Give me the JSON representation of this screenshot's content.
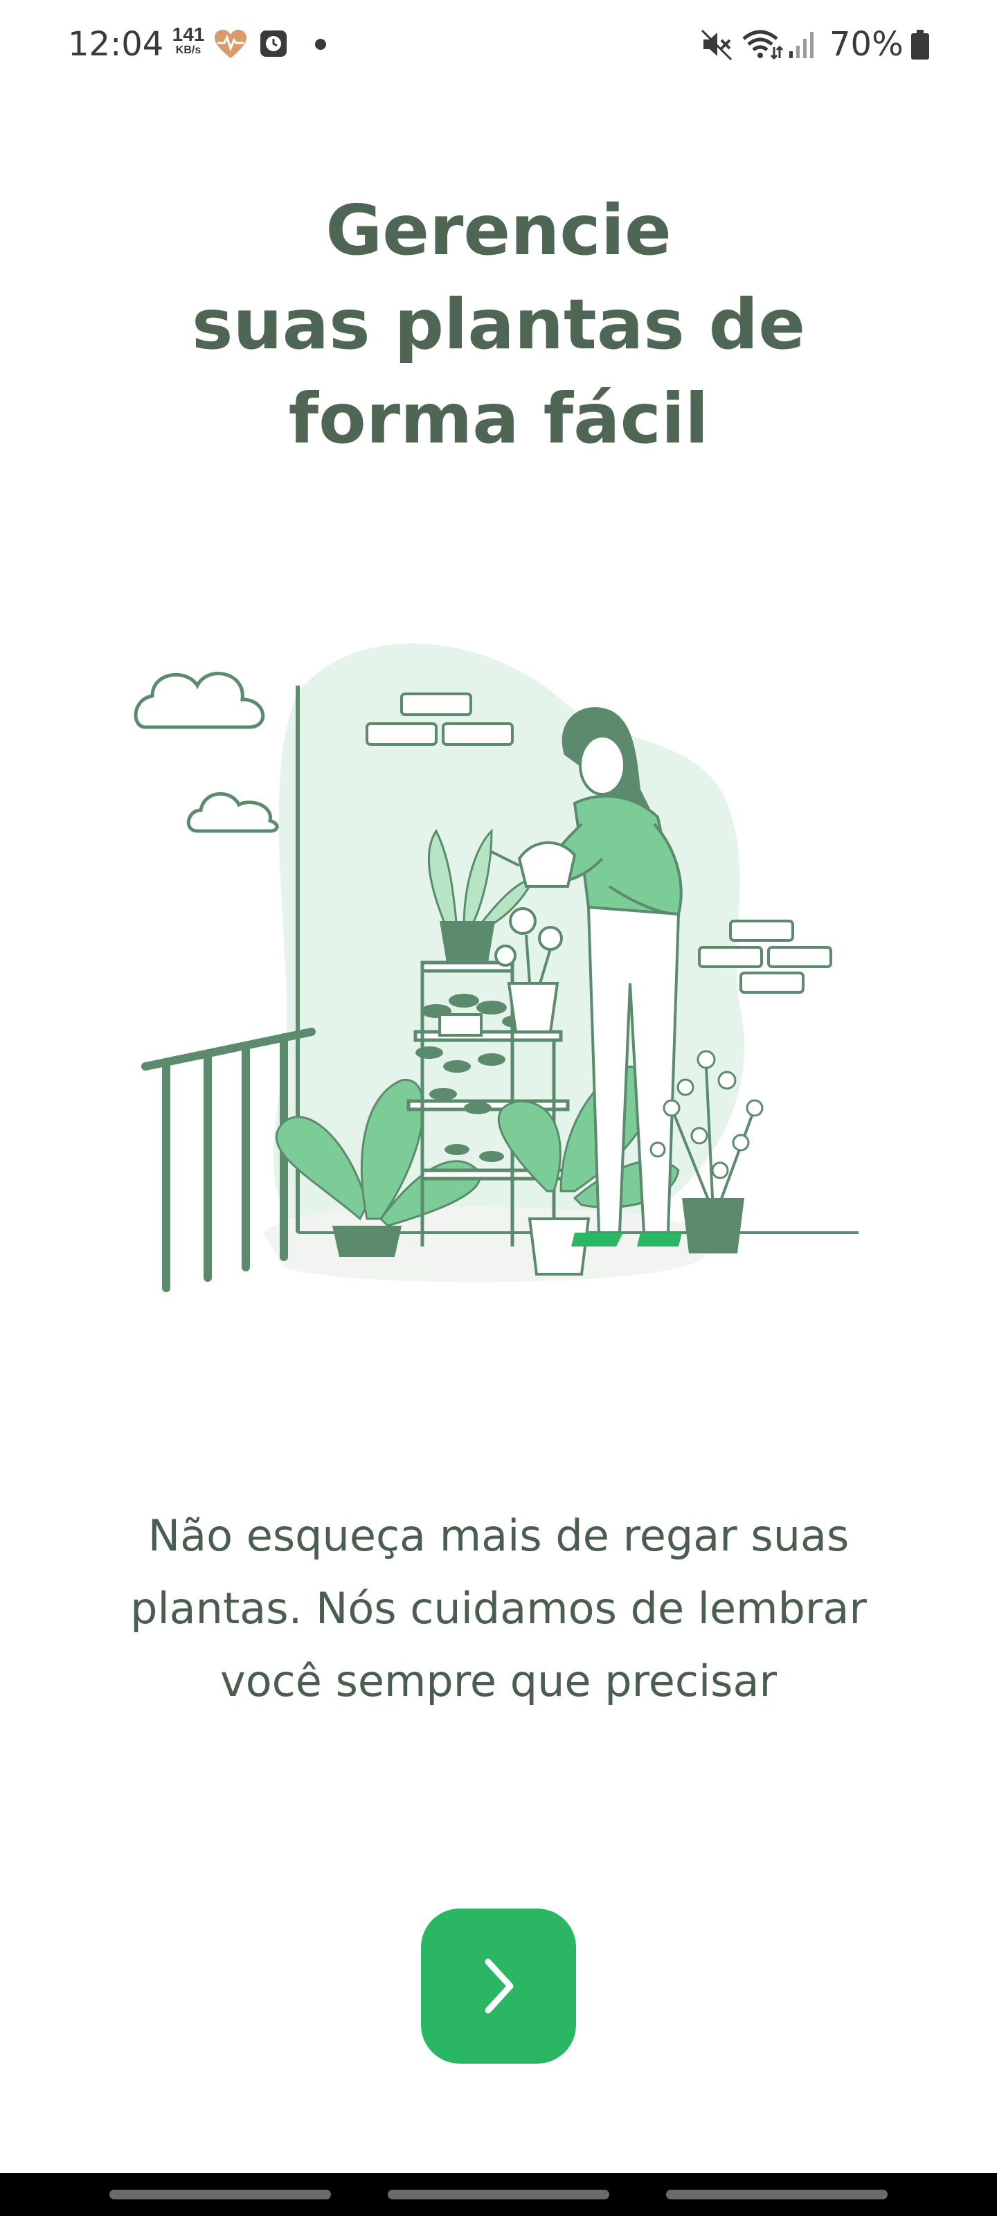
{
  "status_bar": {
    "time": "12:04",
    "net_speed_value": "141",
    "net_speed_unit": "KB/s",
    "battery_percent": "70%",
    "icons": [
      "heart-rate-icon",
      "clock-app-icon",
      "notification-dot-icon",
      "mute-icon",
      "wifi-icon",
      "signal-icon",
      "battery-icon"
    ]
  },
  "onboarding": {
    "title_lines": [
      "Gerencie",
      "suas plantas de",
      "forma fácil"
    ],
    "description_lines": [
      "Não esqueça mais de regar suas",
      "plantas. Nós cuidamos de lembrar",
      "você sempre que precisar"
    ],
    "next_icon": "chevron-right-icon"
  },
  "colors": {
    "title": "#4f6655",
    "accent": "#2bb664",
    "illustration_dark": "#5b8a6d",
    "illustration_light": "#e4f4ea",
    "illustration_mid": "#7ccc97"
  }
}
